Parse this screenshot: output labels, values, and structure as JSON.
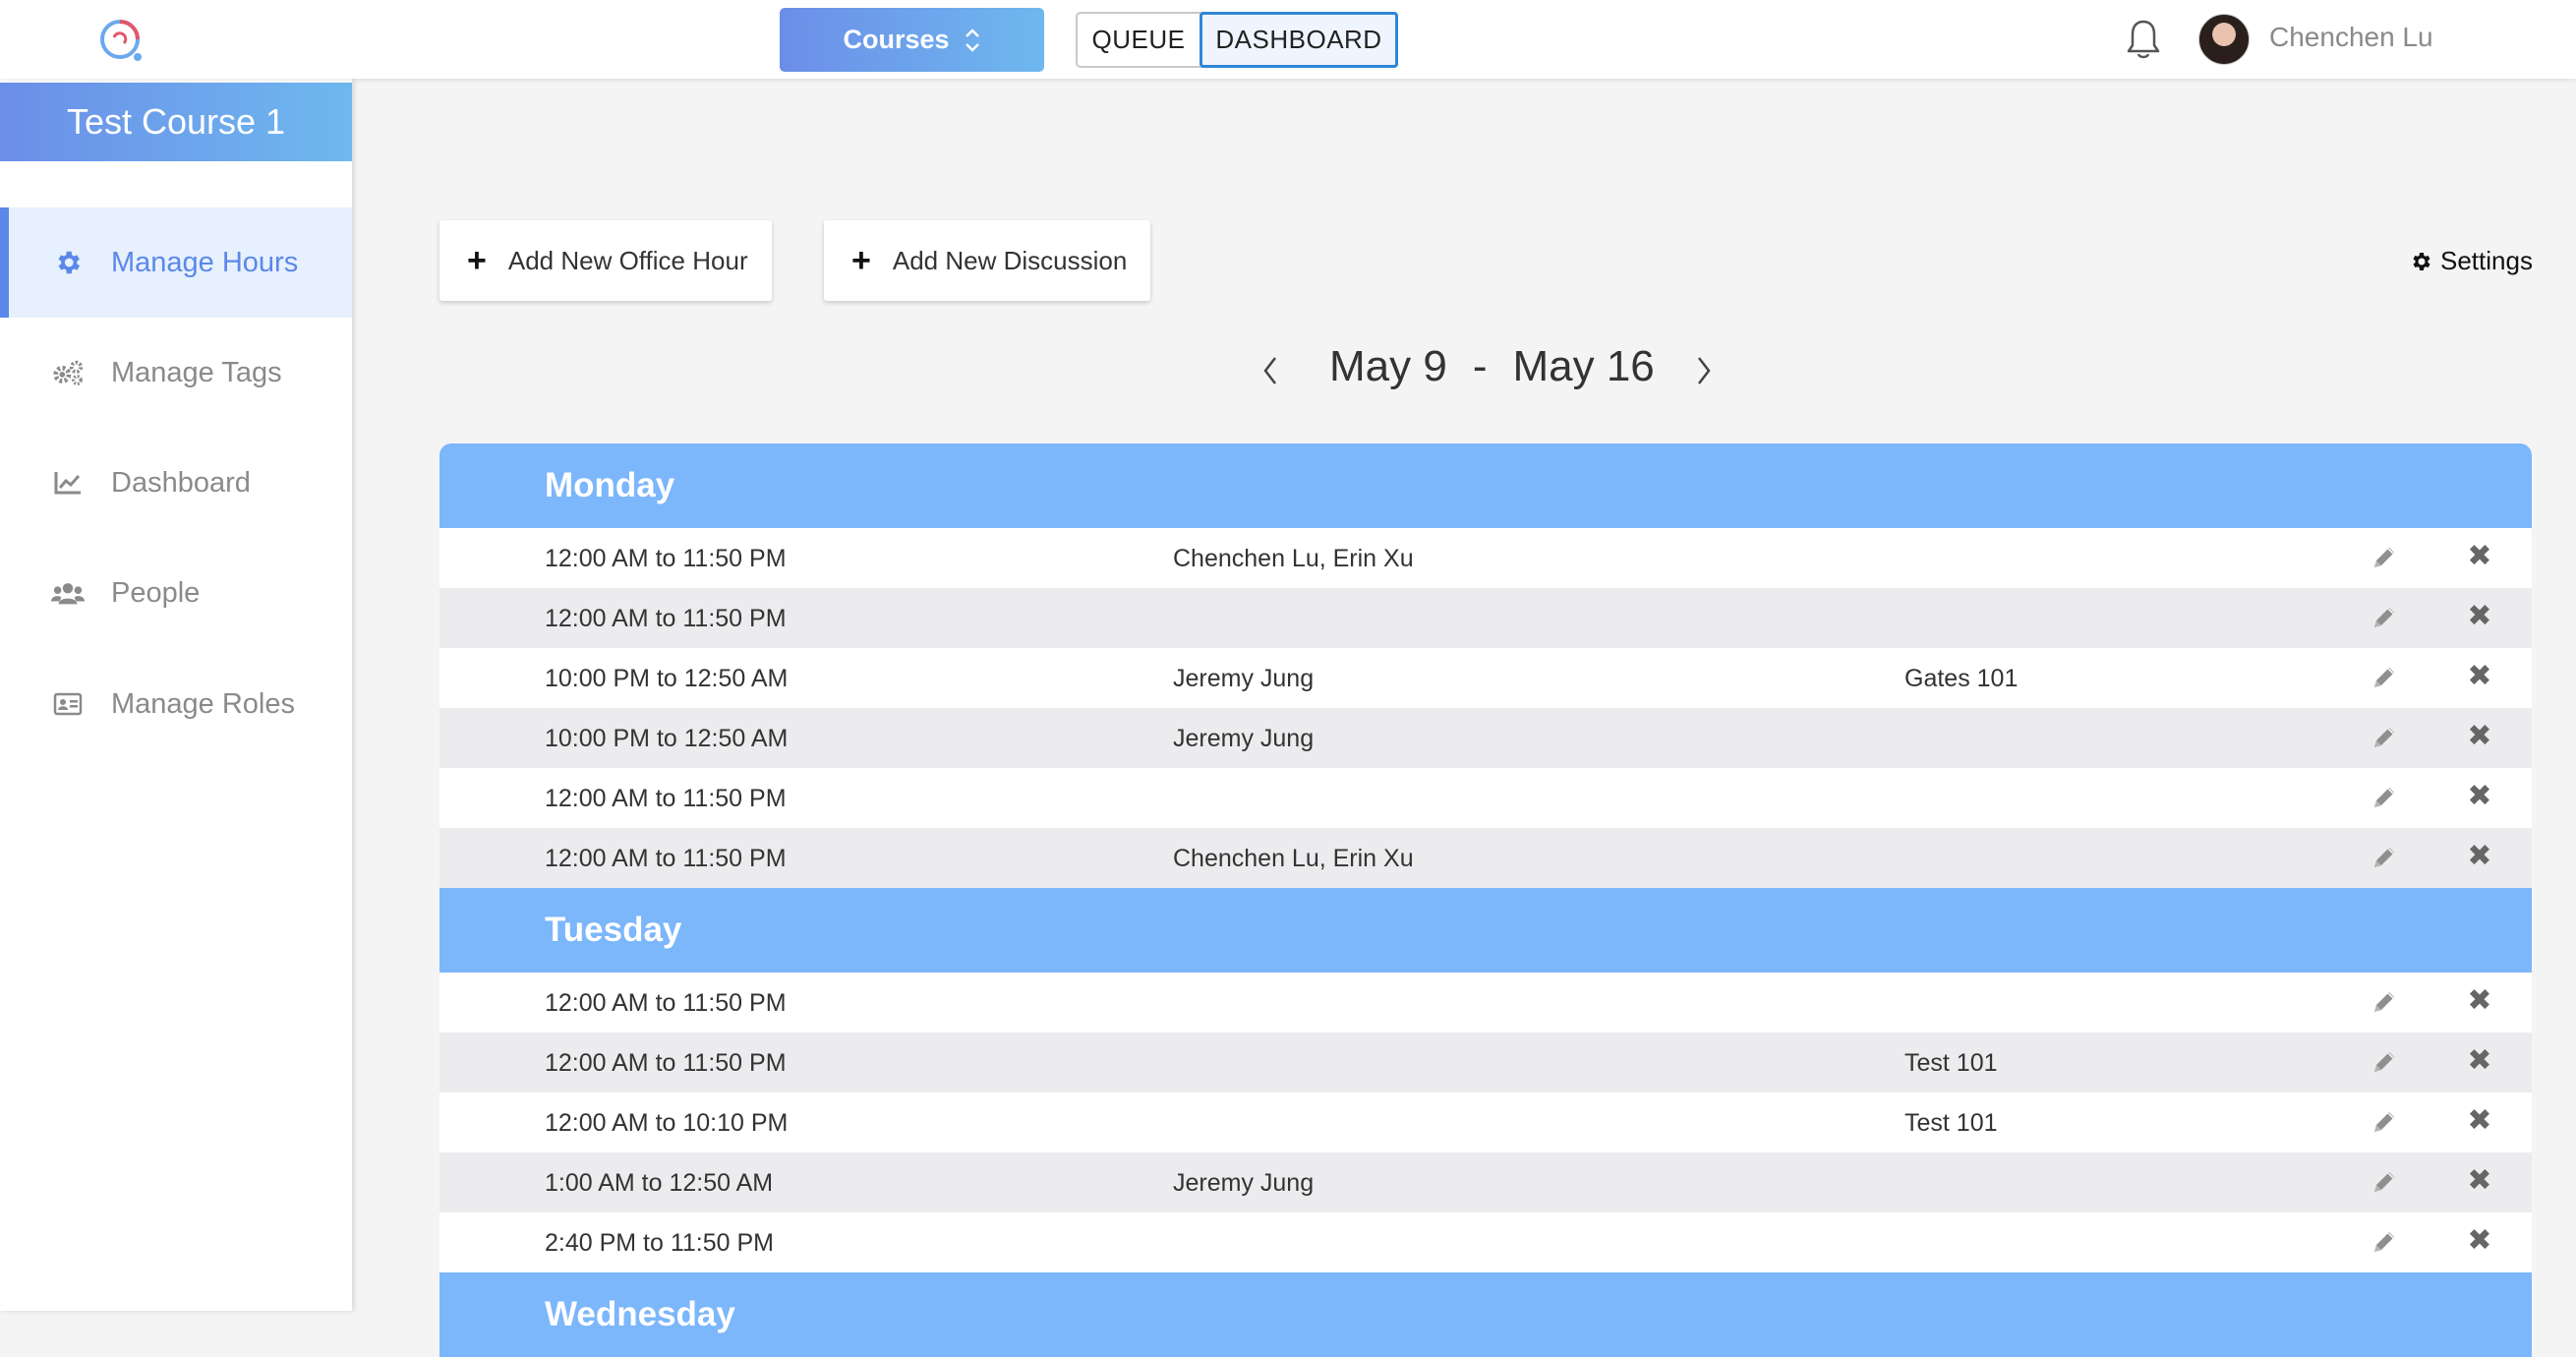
{
  "topbar": {
    "courses_label": "Courses",
    "queue_label": "QUEUE",
    "dashboard_label": "DASHBOARD",
    "user_name": "Chenchen Lu",
    "accent_color": "#6b8ee8"
  },
  "sidebar": {
    "course_title": "Test Course 1",
    "items": [
      {
        "label": "Manage Hours",
        "icon": "gear-icon",
        "active": true
      },
      {
        "label": "Manage Tags",
        "icon": "gears-icon",
        "active": false
      },
      {
        "label": "Dashboard",
        "icon": "chart-icon",
        "active": false
      },
      {
        "label": "People",
        "icon": "users-icon",
        "active": false
      },
      {
        "label": "Manage Roles",
        "icon": "id-card-icon",
        "active": false
      }
    ]
  },
  "actions": {
    "add_office_hour": "Add New Office Hour",
    "add_discussion": "Add New Discussion",
    "settings": "Settings"
  },
  "week": {
    "start": "May 9",
    "separator": "-",
    "end": "May 16"
  },
  "days": [
    {
      "name": "Monday",
      "rows": [
        {
          "time": "12:00 AM to 11:50 PM",
          "hosts": "Chenchen Lu, Erin Xu",
          "room": ""
        },
        {
          "time": "12:00 AM to 11:50 PM",
          "hosts": "",
          "room": ""
        },
        {
          "time": "10:00 PM to 12:50 AM",
          "hosts": "Jeremy Jung",
          "room": "Gates 101"
        },
        {
          "time": "10:00 PM to 12:50 AM",
          "hosts": "Jeremy Jung",
          "room": ""
        },
        {
          "time": "12:00 AM to 11:50 PM",
          "hosts": "",
          "room": ""
        },
        {
          "time": "12:00 AM to 11:50 PM",
          "hosts": "Chenchen Lu, Erin Xu",
          "room": ""
        }
      ]
    },
    {
      "name": "Tuesday",
      "rows": [
        {
          "time": "12:00 AM to 11:50 PM",
          "hosts": "",
          "room": ""
        },
        {
          "time": "12:00 AM to 11:50 PM",
          "hosts": "",
          "room": "Test 101"
        },
        {
          "time": "12:00 AM to 10:10 PM",
          "hosts": "",
          "room": "Test 101"
        },
        {
          "time": "1:00 AM to 12:50 AM",
          "hosts": "Jeremy Jung",
          "room": ""
        },
        {
          "time": "2:40 PM to 11:50 PM",
          "hosts": "",
          "room": ""
        }
      ]
    },
    {
      "name": "Wednesday",
      "rows": []
    }
  ]
}
